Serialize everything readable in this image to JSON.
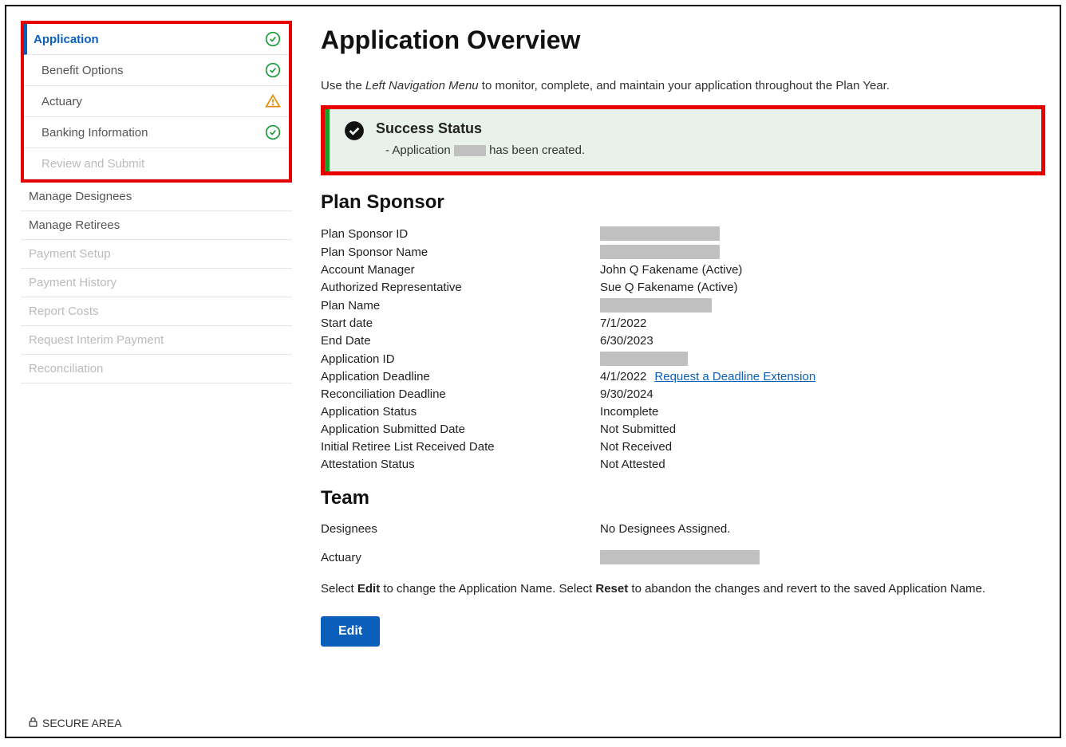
{
  "sidebar": {
    "application": {
      "label": "Application",
      "children": [
        {
          "label": "Benefit Options",
          "status": "check"
        },
        {
          "label": "Actuary",
          "status": "warn"
        },
        {
          "label": "Banking Information",
          "status": "check"
        },
        {
          "label": "Review and Submit",
          "status": "none",
          "disabled": true
        }
      ]
    },
    "other": [
      {
        "label": "Manage Designees",
        "disabled": false
      },
      {
        "label": "Manage Retirees",
        "disabled": false
      },
      {
        "label": "Payment Setup",
        "disabled": true
      },
      {
        "label": "Payment History",
        "disabled": true
      },
      {
        "label": "Report Costs",
        "disabled": true
      },
      {
        "label": "Request Interim Payment",
        "disabled": true
      },
      {
        "label": "Reconciliation",
        "disabled": true
      }
    ]
  },
  "page": {
    "title": "Application Overview",
    "intro_prefix": "Use the ",
    "intro_em": "Left Navigation Menu",
    "intro_suffix": " to monitor, complete, and maintain your application throughout the Plan Year."
  },
  "alert": {
    "title": "Success Status",
    "msg_prefix": "Application ",
    "msg_suffix": " has been created."
  },
  "plan_sponsor": {
    "heading": "Plan Sponsor",
    "rows": {
      "sponsor_id_label": "Plan Sponsor ID",
      "sponsor_name_label": "Plan Sponsor Name",
      "account_manager_label": "Account Manager",
      "account_manager_value": "John Q Fakename (Active)",
      "auth_rep_label": "Authorized Representative",
      "auth_rep_value": "Sue Q Fakename (Active)",
      "plan_name_label": "Plan Name",
      "start_date_label": "Start date",
      "start_date_value": "7/1/2022",
      "end_date_label": "End Date",
      "end_date_value": "6/30/2023",
      "app_id_label": "Application ID",
      "deadline_label": "Application Deadline",
      "deadline_value": "4/1/2022",
      "deadline_link": "Request a Deadline Extension",
      "recon_deadline_label": "Reconciliation Deadline",
      "recon_deadline_value": "9/30/2024",
      "status_label": "Application Status",
      "status_value": "Incomplete",
      "submitted_label": "Application Submitted Date",
      "submitted_value": "Not Submitted",
      "retiree_list_label": "Initial Retiree List Received Date",
      "retiree_list_value": "Not Received",
      "attestation_label": "Attestation Status",
      "attestation_value": "Not Attested"
    }
  },
  "team": {
    "heading": "Team",
    "designees_label": "Designees",
    "designees_value": "No Designees Assigned.",
    "actuary_label": "Actuary"
  },
  "note": {
    "p1": "Select ",
    "b1": "Edit",
    "p2": " to change the Application Name. Select ",
    "b2": "Reset",
    "p3": " to abandon the changes and revert to the saved Application Name."
  },
  "buttons": {
    "edit": "Edit"
  },
  "footer": "SECURE AREA"
}
